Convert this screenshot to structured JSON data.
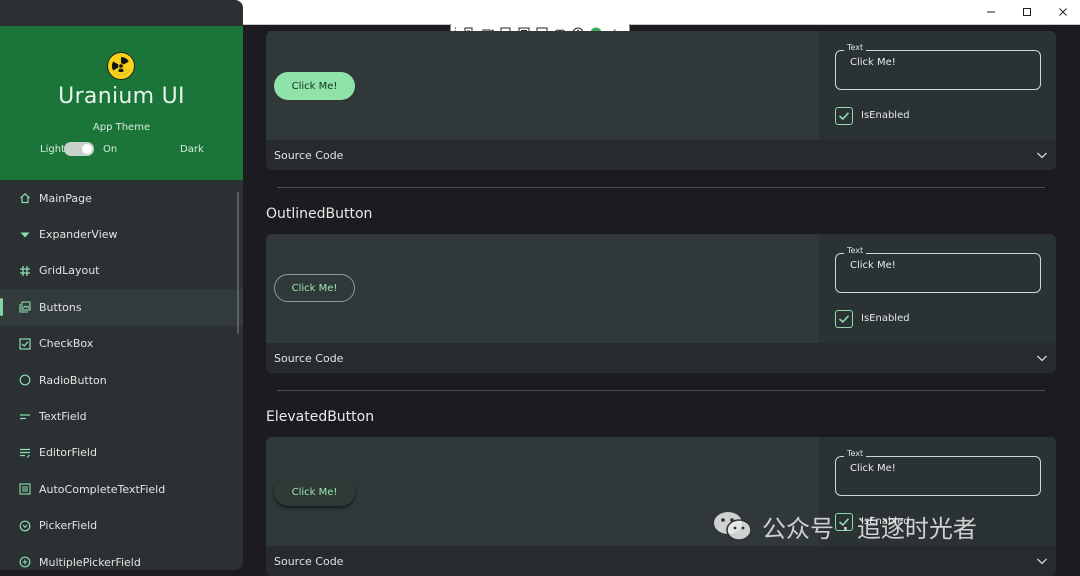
{
  "sidebar": {
    "brand": "Uranium UI",
    "app_theme_label": "App Theme",
    "theme_light": "Light",
    "theme_toggle_state": "On",
    "theme_dark": "Dark",
    "items": [
      {
        "label": "MainPage",
        "icon": "home-icon"
      },
      {
        "label": "ExpanderView",
        "icon": "caret-down-icon"
      },
      {
        "label": "GridLayout",
        "icon": "hash-icon"
      },
      {
        "label": "Buttons",
        "icon": "gallery-icon",
        "active": true
      },
      {
        "label": "CheckBox",
        "icon": "checkbox-icon"
      },
      {
        "label": "RadioButton",
        "icon": "radio-icon"
      },
      {
        "label": "TextField",
        "icon": "textfield-icon"
      },
      {
        "label": "EditorField",
        "icon": "editor-icon"
      },
      {
        "label": "AutoCompleteTextField",
        "icon": "list-icon"
      },
      {
        "label": "PickerField",
        "icon": "picker-icon"
      },
      {
        "label": "MultiplePickerField",
        "icon": "multi-picker-icon"
      }
    ]
  },
  "sections": {
    "filled": {
      "button_label": "Click Me!",
      "text_label": "Text",
      "text_value": "Click Me!",
      "checkbox_label": "IsEnabled",
      "source_label": "Source Code"
    },
    "outlined": {
      "title": "OutlinedButton",
      "button_label": "Click Me!",
      "text_label": "Text",
      "text_value": "Click Me!",
      "checkbox_label": "IsEnabled",
      "source_label": "Source Code"
    },
    "elevated": {
      "title": "ElevatedButton",
      "button_label": "Click Me!",
      "text_label": "Text",
      "text_value": "Click Me!",
      "checkbox_label": "IsEnabled",
      "source_label": "Source Code"
    }
  },
  "watermark": {
    "text": "公众号 · 追逐时光者"
  },
  "colors": {
    "accent": "#8fe3a8",
    "header_green": "#1b7538",
    "background": "#1c1b1f"
  }
}
